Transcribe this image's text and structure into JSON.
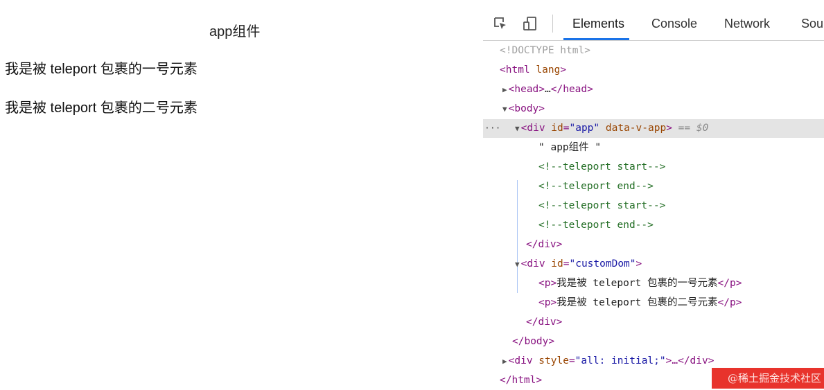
{
  "viewport": {
    "app_title": "app组件",
    "paragraphs": [
      "我是被 teleport 包裹的一号元素",
      "我是被 teleport 包裹的二号元素"
    ]
  },
  "devtools": {
    "tools": [
      "inspect-element-icon",
      "device-toolbar-icon"
    ],
    "tabs": [
      "Elements",
      "Console",
      "Network",
      "Sou"
    ],
    "active_tab": "Elements",
    "accent_color": "#1a73e8",
    "tree": {
      "doctype": "<!DOCTYPE html>",
      "html_open": "<html",
      "html_attr": "lang",
      "html_close_bracket": ">",
      "head_open": "<head>",
      "head_ellipsis": "…",
      "head_close": "</head>",
      "body_open": "<body>",
      "selected_row_dots": "···",
      "app_div_open": "<div",
      "app_attr_id": "id",
      "app_attr_id_value": "\"app\"",
      "app_attr_data": "data-v-app",
      "app_div_gt": ">",
      "selected_marker": "== $0",
      "app_text": "\" app组件 \"",
      "comments": [
        "<!--teleport start-->",
        "<!--teleport end-->",
        "<!--teleport start-->",
        "<!--teleport end-->"
      ],
      "div_close": "</div>",
      "custom_div_open": "<div",
      "custom_attr_id": "id",
      "custom_attr_id_value": "\"customDom\"",
      "custom_div_gt": ">",
      "p_open": "<p>",
      "p_close": "</p>",
      "p_texts": [
        "我是被 teleport 包裹的一号元素",
        "我是被 teleport 包裹的二号元素"
      ],
      "body_close": "</body>",
      "ext_div_open": "<div",
      "ext_attr": "style",
      "ext_attr_value": "\"all: initial;\"",
      "ext_gt_ellipsis": ">…",
      "html_close": "</html>"
    }
  },
  "watermark": "@稀土掘金技术社区"
}
